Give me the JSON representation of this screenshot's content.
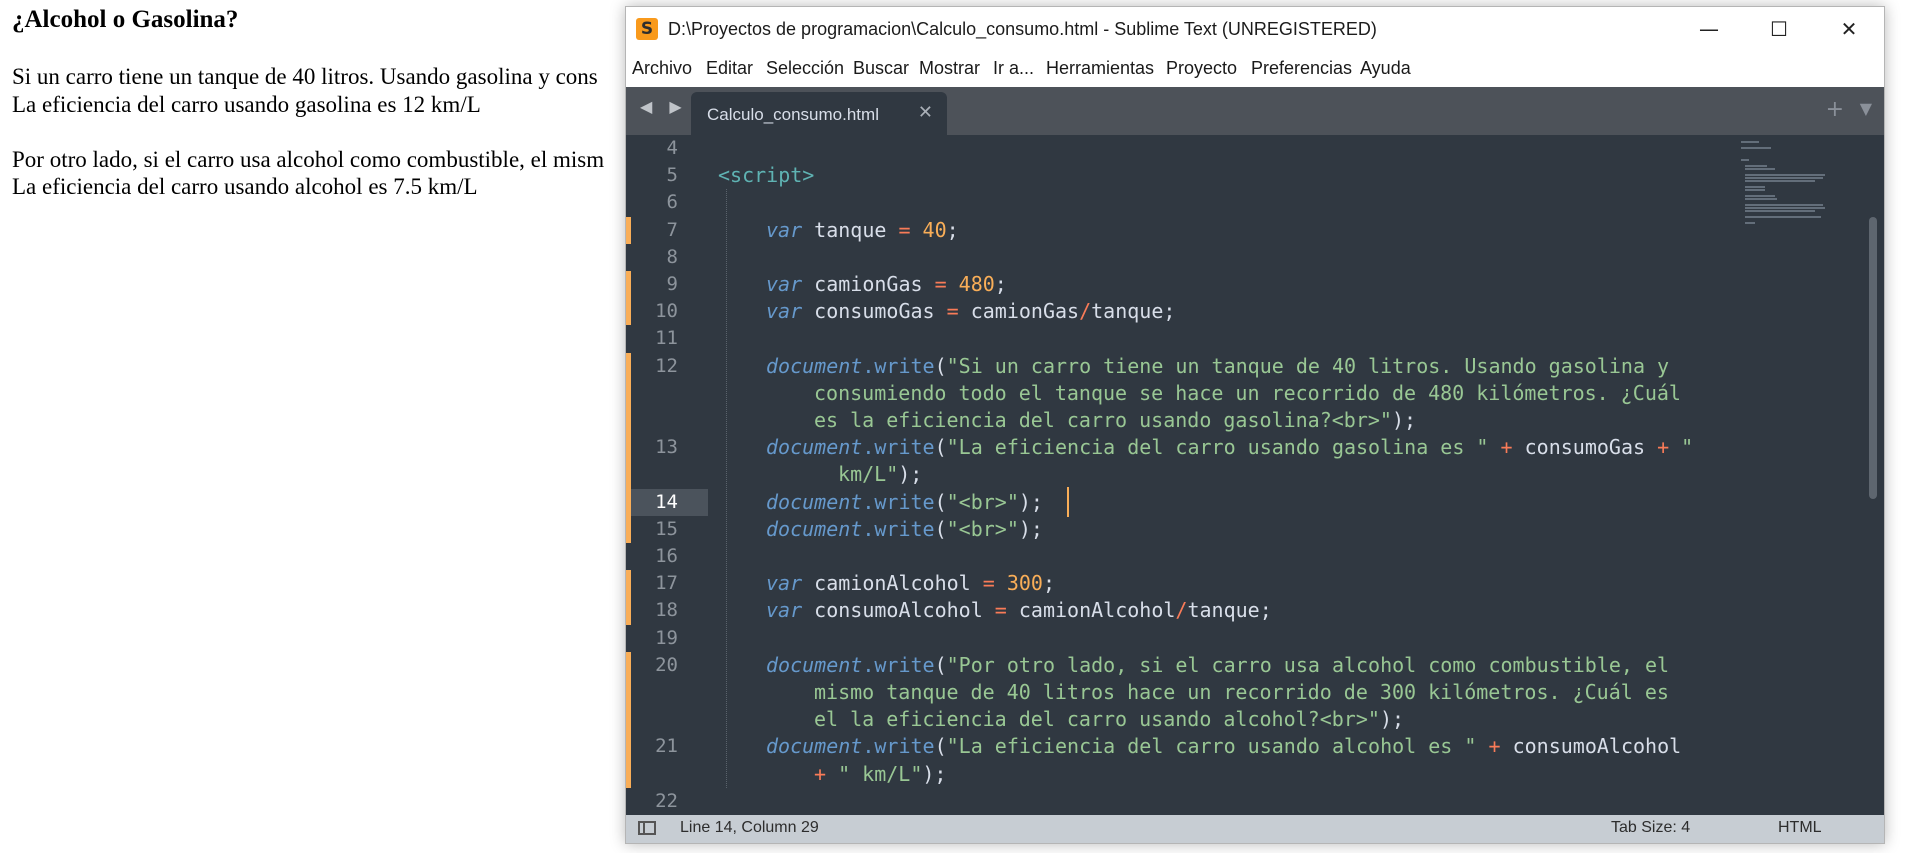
{
  "page": {
    "heading": "¿Alcohol o Gasolina?",
    "lines": [
      "Si un carro tiene un tanque de 40 litros. Usando gasolina y cons",
      "La eficiencia del carro usando gasolina es 12 km/L",
      "Por otro lado, si el carro usa alcohol como combustible, el mism",
      "La eficiencia del carro usando alcohol es 7.5 km/L"
    ]
  },
  "window": {
    "title": "D:\\Proyectos de programacion\\Calculo_consumo.html - Sublime Text (UNREGISTERED)",
    "minimize": "—",
    "maximize": "☐",
    "close": "✕",
    "app_icon": "S"
  },
  "menu": [
    "Archivo",
    "Editar",
    "Selección",
    "Buscar",
    "Mostrar",
    "Ir a...",
    "Herramientas",
    "Proyecto",
    "Preferencias",
    "Ayuda"
  ],
  "tabs": {
    "nav_arrows": "◀ ▶",
    "active_tab": "Calculo_consumo.html",
    "close": "✕",
    "plus": "+",
    "menu": "▼"
  },
  "line_numbers": [
    "4",
    "5",
    "6",
    "7",
    "8",
    "9",
    "10",
    "11",
    "12",
    "",
    "",
    "13",
    "",
    "14",
    "15",
    "16",
    "17",
    "18",
    "19",
    "20",
    "",
    "",
    "21",
    "",
    "22"
  ],
  "code": {
    "l5_tag": "<script>",
    "l7": {
      "kw": "var",
      "name": " tanque ",
      "eq": "=",
      "num": " 40",
      "end": ";"
    },
    "l9": {
      "kw": "var",
      "name": " camionGas ",
      "eq": "=",
      "num": " 480",
      "end": ";"
    },
    "l10": {
      "kw": "var",
      "name": " consumoGas ",
      "eq": "=",
      "a": " camionGas",
      "op": "/",
      "b": "tanque;"
    },
    "l12": {
      "obj": "document",
      "fn": ".write",
      "open": "(",
      "s1": "\"Si un carro tiene un tanque de 40 litros. Usando gasolina y",
      "s2": "consumiendo todo el tanque se hace un recorrido de 480 kilómetros. ¿Cuál",
      "s3": "es la eficiencia del carro usando gasolina?<br>\"",
      "close": ");"
    },
    "l13": {
      "obj": "document",
      "fn": ".write",
      "open": "(",
      "s1": "\"La eficiencia del carro usando gasolina es \"",
      "plus1": " +",
      "v": " consumoGas",
      "plus2": " +",
      "s2": " \"",
      "s3": " km/L\"",
      "close": ");"
    },
    "l14": {
      "obj": "document",
      "fn": ".write",
      "open": "(",
      "s": "\"<br>\"",
      "close": ");"
    },
    "l15": {
      "obj": "document",
      "fn": ".write",
      "open": "(",
      "s": "\"<br>\"",
      "close": ");"
    },
    "l17": {
      "kw": "var",
      "name": " camionAlcohol ",
      "eq": "=",
      "num": " 300",
      "end": ";"
    },
    "l18": {
      "kw": "var",
      "name": " consumoAlcohol ",
      "eq": "=",
      "a": " camionAlcohol",
      "op": "/",
      "b": "tanque;"
    },
    "l20": {
      "obj": "document",
      "fn": ".write",
      "open": "(",
      "s1": "\"Por otro lado, si el carro usa alcohol como combustible, el",
      "s2": "mismo tanque de 40 litros hace un recorrido de 300 kilómetros. ¿Cuál es",
      "s3": "el la eficiencia del carro usando alcohol?<br>\"",
      "close": ");"
    },
    "l21": {
      "obj": "document",
      "fn": ".write",
      "open": "(",
      "s1": "\"La eficiencia del carro usando alcohol es \"",
      "plus1": " +",
      "v": " consumoAlcohol",
      "plus2": "+",
      "s2": " \" km/L\"",
      "close": ");"
    }
  },
  "status": {
    "position": "Line 14, Column 29",
    "tab_size": "Tab Size: 4",
    "syntax": "HTML"
  }
}
